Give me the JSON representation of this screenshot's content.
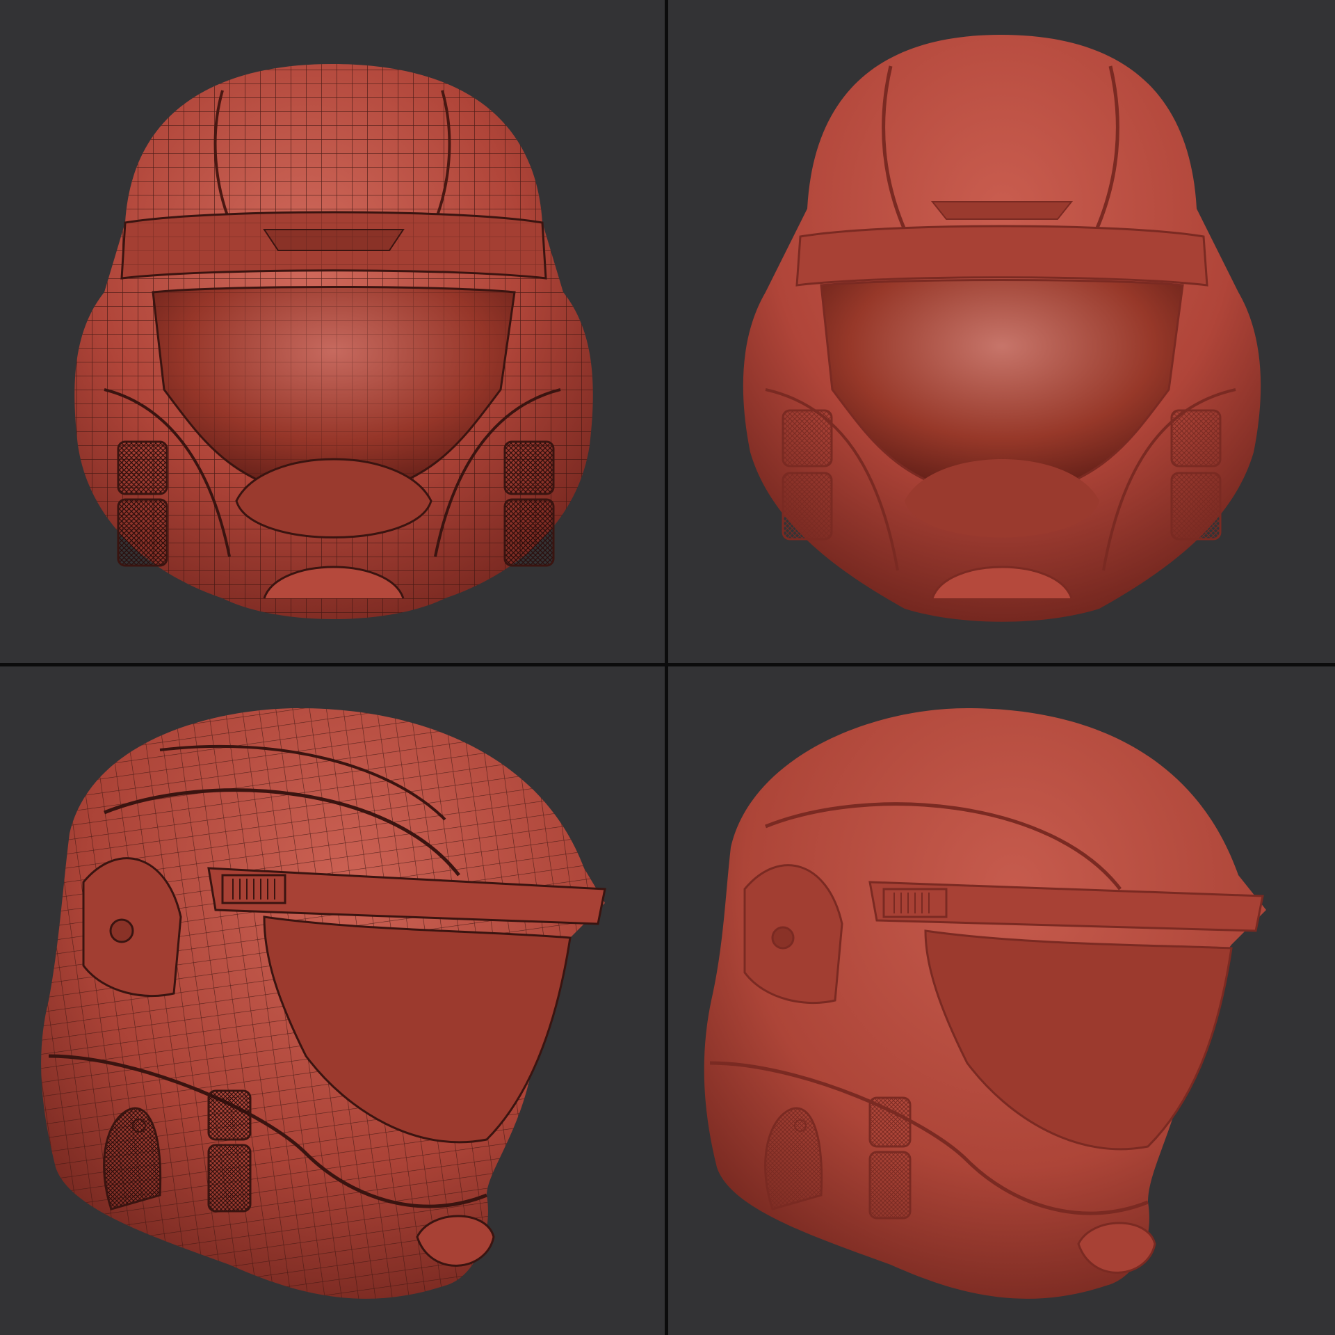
{
  "layout": "2x2-grid",
  "colors": {
    "background": "#333335",
    "divider": "#0c0c0c",
    "clay": "#b5493c",
    "clay_light": "#cf6a5c",
    "clay_dark": "#6e231c",
    "wire": "#3a1410"
  },
  "panels": [
    {
      "view": "front",
      "shading": "wireframe-on-shaded"
    },
    {
      "view": "front",
      "shading": "smooth-shaded"
    },
    {
      "view": "three-quarter-left",
      "shading": "wireframe-on-shaded"
    },
    {
      "view": "three-quarter-left",
      "shading": "smooth-shaded"
    }
  ]
}
